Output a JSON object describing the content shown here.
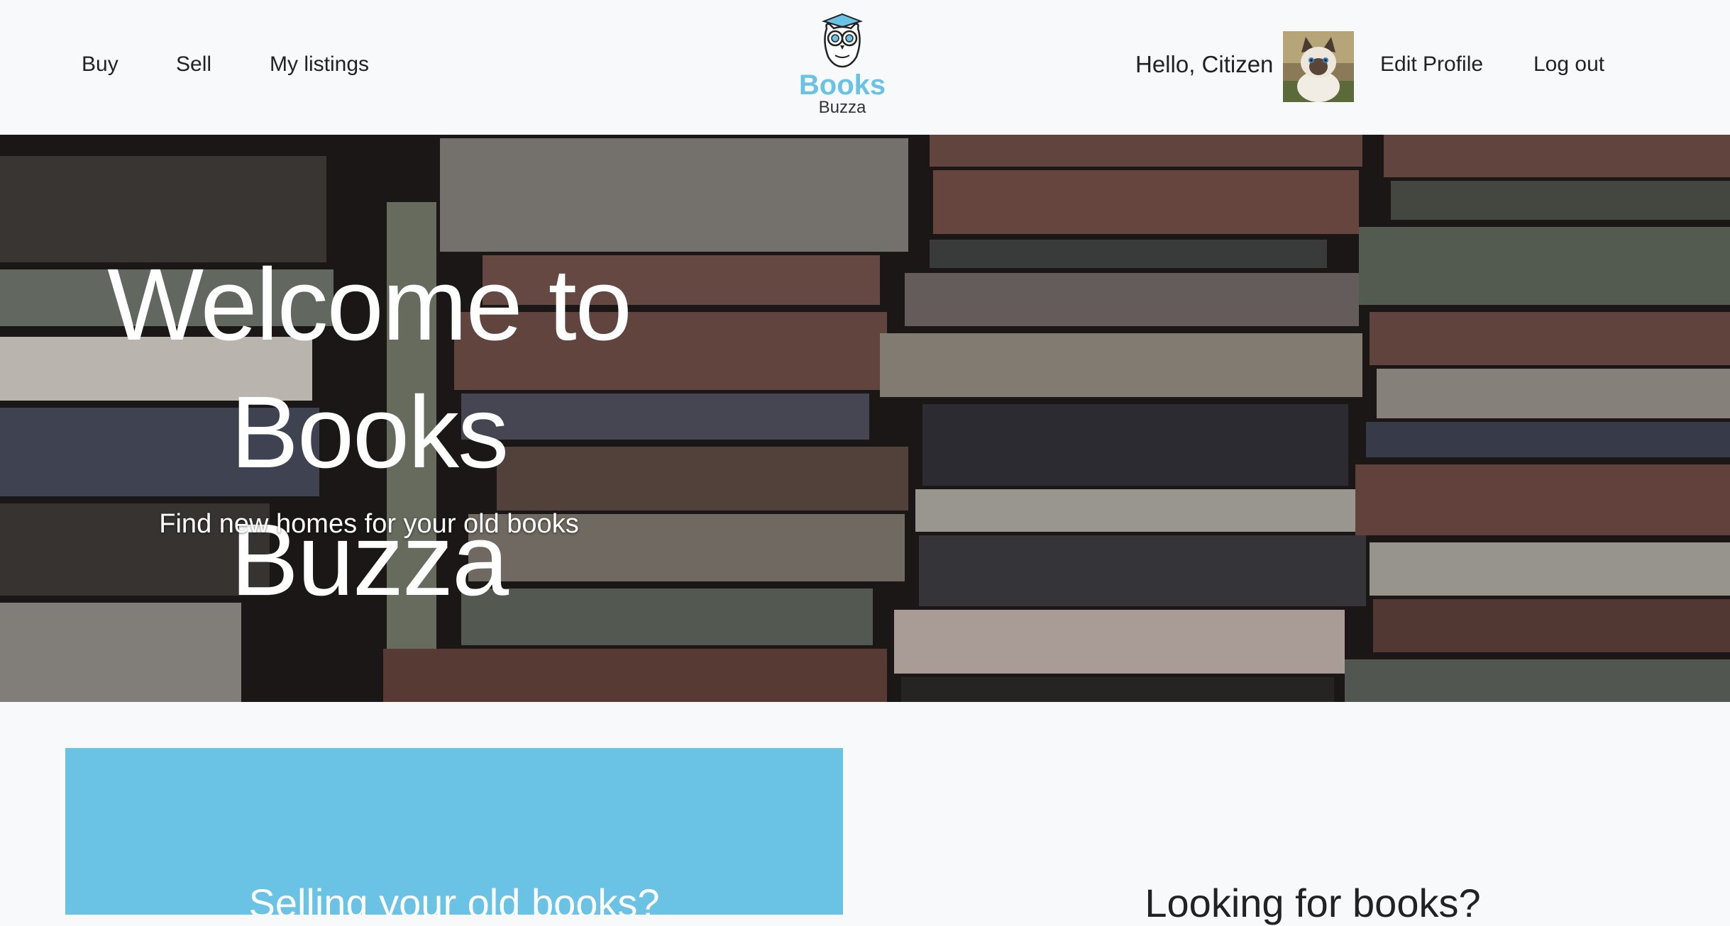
{
  "nav": {
    "buy": "Buy",
    "sell": "Sell",
    "my_listings": "My listings"
  },
  "logo": {
    "word1": "Books",
    "word2": "Buzza",
    "icon": "owl-logo-icon"
  },
  "user": {
    "greeting": "Hello, Citizen",
    "avatar": "cat-avatar",
    "edit_profile": "Edit Profile",
    "log_out": "Log out"
  },
  "hero": {
    "title_line1": "Welcome to",
    "title_line2": "Books Buzza",
    "subtitle": "Find new homes for your old books"
  },
  "sections": {
    "sell_heading": "Selling your old books?",
    "buy_heading": "Looking for books?"
  },
  "colors": {
    "brand_blue": "#6ac2e4",
    "background": "#f8f9fb"
  }
}
